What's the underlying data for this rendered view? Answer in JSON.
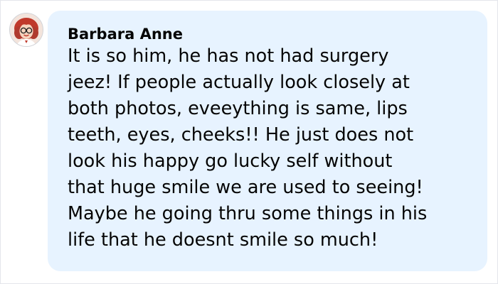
{
  "comment": {
    "author": "Barbara Anne",
    "lines": [
      "It is so him, he has not had surgery",
      "jeez! If people actually look closely at",
      "both photos, eveeything is same, lips",
      "teeth, eyes, cheeks!! He just does not",
      "look his happy go lucky self without",
      "that huge smile we are used to seeing!",
      "Maybe he going thru some things in his",
      "life that he doesnt smile so much!"
    ]
  },
  "colors": {
    "bubble_background": "#e7f3ff",
    "text": "#050505",
    "frame_border": "#e4e6eb"
  }
}
